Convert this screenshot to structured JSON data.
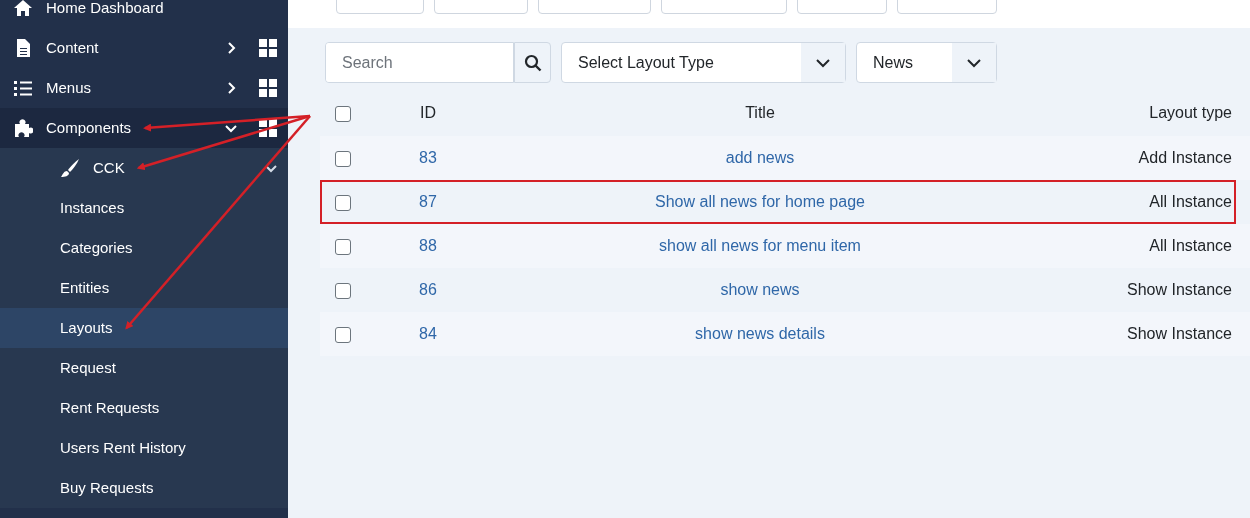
{
  "sidebar": {
    "items": [
      {
        "label": "Home Dashboard",
        "annotated": false
      },
      {
        "label": "Content",
        "expanded": false,
        "annotated": false
      },
      {
        "label": "Menus",
        "expanded": false,
        "annotated": false
      },
      {
        "label": "Components",
        "expanded": true,
        "annotated": true,
        "children": [
          {
            "label": "CCK",
            "expanded": true,
            "annotated": true,
            "children": [
              {
                "label": "Instances",
                "selected": false,
                "annotated": false
              },
              {
                "label": "Categories",
                "selected": false,
                "annotated": false
              },
              {
                "label": "Entities",
                "selected": false,
                "annotated": false
              },
              {
                "label": "Layouts",
                "selected": true,
                "annotated": true
              },
              {
                "label": "Request",
                "selected": false,
                "annotated": false
              },
              {
                "label": "Rent Requests",
                "selected": false,
                "annotated": false
              },
              {
                "label": "Users Rent History",
                "selected": false,
                "annotated": false
              },
              {
                "label": "Buy Requests",
                "selected": false,
                "annotated": false
              }
            ]
          }
        ]
      }
    ]
  },
  "filters": {
    "search": {
      "placeholder": "Search"
    },
    "layout_type": {
      "value": "Select Layout Type"
    },
    "category": {
      "value": "News"
    }
  },
  "table": {
    "select_all_checked": false,
    "columns": [
      "ID",
      "Title",
      "Layout type"
    ],
    "rows": [
      {
        "id": "83",
        "title": "add news",
        "layout_type": "Add Instance",
        "checked": false,
        "highlighted": false
      },
      {
        "id": "87",
        "title": "Show all news for home page",
        "layout_type": "All Instance",
        "checked": false,
        "highlighted": true
      },
      {
        "id": "88",
        "title": "show all news for menu item",
        "layout_type": "All Instance",
        "checked": false,
        "highlighted": false
      },
      {
        "id": "86",
        "title": "show news",
        "layout_type": "Show Instance",
        "checked": false,
        "highlighted": false
      },
      {
        "id": "84",
        "title": "show news details",
        "layout_type": "Show Instance",
        "checked": false,
        "highlighted": false
      }
    ]
  }
}
